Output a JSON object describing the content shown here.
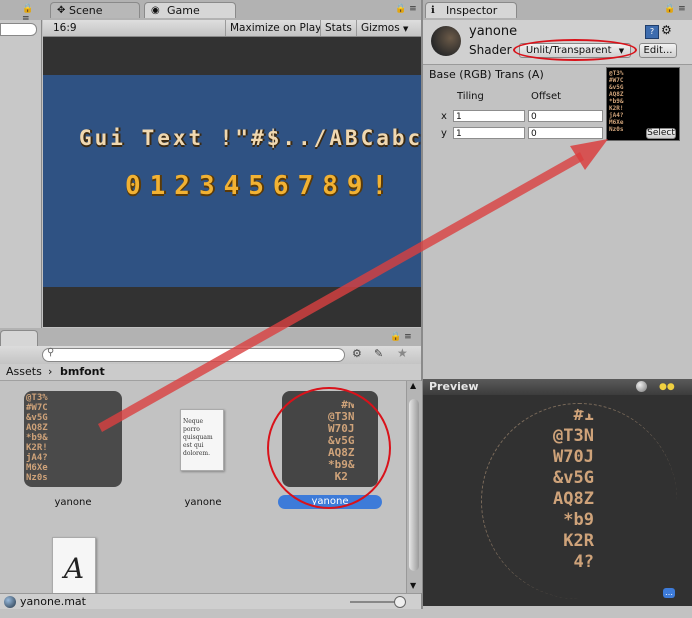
{
  "tabs": {
    "scene": "Scene",
    "game": "Game",
    "inspector": "Inspector"
  },
  "game_toolbar": {
    "aspect": "16:9",
    "maximize": "Maximize on Play",
    "stats": "Stats",
    "gizmos": "Gizmos"
  },
  "game_view": {
    "text_line": "Gui Text !\"#$../ABCabcg",
    "digits_line": "0123456789!"
  },
  "inspector": {
    "object_name": "yanone",
    "shader_label": "Shader",
    "shader_value": "Unlit/Transparent",
    "edit_button": "Edit...",
    "texture_label": "Base (RGB) Trans (A)",
    "tiling_label": "Tiling",
    "offset_label": "Offset",
    "x_label": "x",
    "y_label": "y",
    "tiling_x": "1",
    "tiling_y": "1",
    "offset_x": "0",
    "offset_y": "0",
    "select_button": "Select"
  },
  "preview": {
    "title": "Preview"
  },
  "project": {
    "breadcrumb_root": "Assets",
    "breadcrumb_folder": "bmfont",
    "items": [
      {
        "label": "yanone"
      },
      {
        "label": "yanone"
      },
      {
        "label": "yanone"
      },
      {
        "label": ""
      }
    ],
    "doc_text": "Neque porro quisquam est qui dolorem.",
    "font_glyph": "A",
    "status_file": "yanone.mat"
  },
  "colors": {
    "game_bg": "#2f5283",
    "selection": "#3d7bd9",
    "highlight_circle": "#d9121a",
    "arrow": "#d94040"
  }
}
